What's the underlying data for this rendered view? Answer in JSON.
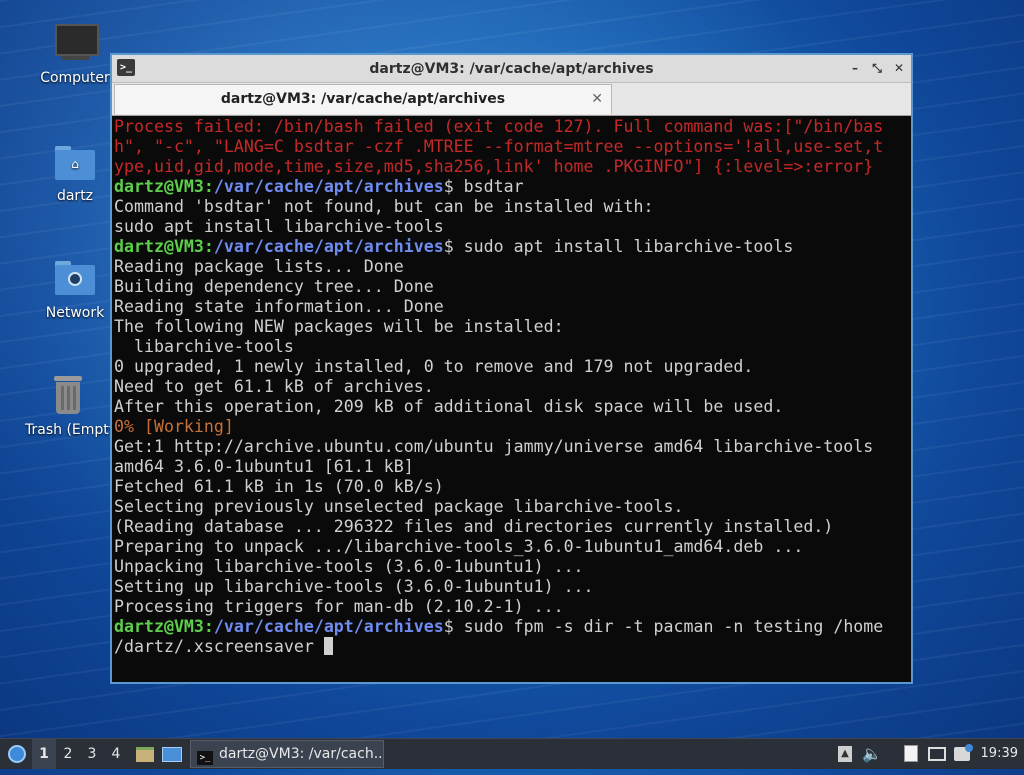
{
  "desktop": {
    "icons": [
      {
        "label": "Computer",
        "icon": "computer-icon"
      },
      {
        "label": "dartz",
        "icon": "home-folder-icon"
      },
      {
        "label": "Network",
        "icon": "network-folder-icon"
      },
      {
        "label": "Trash (Empty)",
        "icon": "trash-icon"
      }
    ]
  },
  "window": {
    "title": "dartz@VM3: /var/cache/apt/archives",
    "tab_label": "dartz@VM3: /var/cache/apt/archives",
    "controls": {
      "minimize": "–",
      "maximize": "⤡",
      "close": "✕"
    },
    "tab_close": "✕"
  },
  "terminal": {
    "prompt_user": "dartz@VM3",
    "prompt_path": "/var/cache/apt/archives",
    "lines": [
      {
        "type": "err",
        "text": "Process failed: /bin/bash failed (exit code 127). Full command was:[\"/bin/bas"
      },
      {
        "type": "err",
        "text": "h\", \"-c\", \"LANG=C bsdtar -czf .MTREE --format=mtree --options='!all,use-set,t"
      },
      {
        "type": "err",
        "text": "ype,uid,gid,mode,time,size,md5,sha256,link' home .PKGINFO\"] {:level=>:error}"
      },
      {
        "type": "prompt",
        "text": "$ bsdtar"
      },
      {
        "type": "out",
        "text": "Command 'bsdtar' not found, but can be installed with:"
      },
      {
        "type": "out",
        "text": "sudo apt install libarchive-tools"
      },
      {
        "type": "prompt",
        "text": "$ sudo apt install libarchive-tools"
      },
      {
        "type": "out",
        "text": "Reading package lists... Done"
      },
      {
        "type": "out",
        "text": "Building dependency tree... Done"
      },
      {
        "type": "out",
        "text": "Reading state information... Done"
      },
      {
        "type": "out",
        "text": "The following NEW packages will be installed:"
      },
      {
        "type": "out",
        "text": "  libarchive-tools"
      },
      {
        "type": "out",
        "text": "0 upgraded, 1 newly installed, 0 to remove and 179 not upgraded."
      },
      {
        "type": "out",
        "text": "Need to get 61.1 kB of archives."
      },
      {
        "type": "out",
        "text": "After this operation, 209 kB of additional disk space will be used."
      },
      {
        "type": "warn",
        "text": "0% [Working]"
      },
      {
        "type": "out",
        "text": "Get:1 http://archive.ubuntu.com/ubuntu jammy/universe amd64 libarchive-tools"
      },
      {
        "type": "out",
        "text": "amd64 3.6.0-1ubuntu1 [61.1 kB]"
      },
      {
        "type": "out",
        "text": "Fetched 61.1 kB in 1s (70.0 kB/s)"
      },
      {
        "type": "out",
        "text": "Selecting previously unselected package libarchive-tools."
      },
      {
        "type": "out",
        "text": "(Reading database ... 296322 files and directories currently installed.)"
      },
      {
        "type": "out",
        "text": "Preparing to unpack .../libarchive-tools_3.6.0-1ubuntu1_amd64.deb ..."
      },
      {
        "type": "out",
        "text": "Unpacking libarchive-tools (3.6.0-1ubuntu1) ..."
      },
      {
        "type": "out",
        "text": "Setting up libarchive-tools (3.6.0-1ubuntu1) ..."
      },
      {
        "type": "out",
        "text": "Processing triggers for man-db (2.10.2-1) ..."
      },
      {
        "type": "prompt",
        "text": "$ sudo fpm -s dir -t pacman -n testing /home"
      },
      {
        "type": "out_cursor",
        "text": "/dartz/.xscreensaver "
      }
    ]
  },
  "taskbar": {
    "start_icon": "start-menu-icon",
    "workspaces": [
      "1",
      "2",
      "3",
      "4"
    ],
    "active_workspace": "1",
    "quicklaunch": [
      "file-manager-icon",
      "show-desktop-icon"
    ],
    "task_label": "dartz@VM3: /var/cach...",
    "tray": [
      "updates-icon",
      "volume-icon",
      "clipboard-icon",
      "network-icon",
      "notification-icon"
    ],
    "clock": "19:39"
  },
  "colors": {
    "error": "#c62828",
    "warning": "#c8703a",
    "prompt_user": "#5cd04a",
    "prompt_path": "#6f8cf0"
  }
}
